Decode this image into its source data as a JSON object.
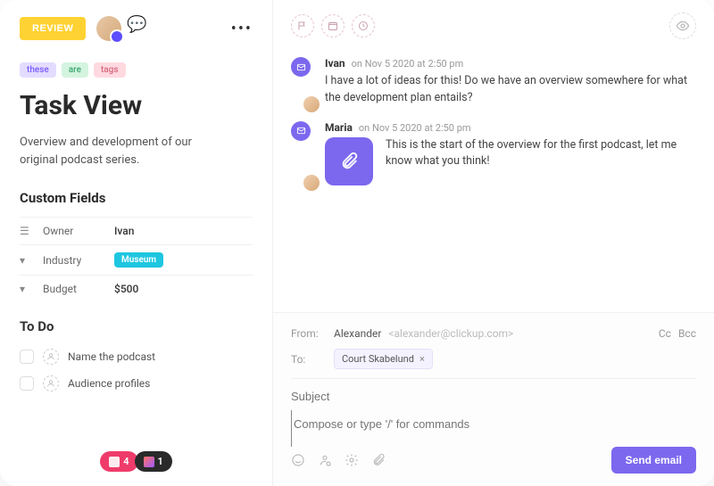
{
  "header": {
    "review_label": "REVIEW"
  },
  "tags": [
    "these",
    "are",
    "tags"
  ],
  "title": "Task View",
  "description": "Overview and development of our original podcast series.",
  "custom_fields": {
    "heading": "Custom Fields",
    "rows": [
      {
        "label": "Owner",
        "value": "Ivan"
      },
      {
        "label": "Industry",
        "value": "Museum"
      },
      {
        "label": "Budget",
        "value": "$500"
      }
    ]
  },
  "todo": {
    "heading": "To Do",
    "items": [
      {
        "label": "Name the podcast"
      },
      {
        "label": "Audience profiles"
      }
    ]
  },
  "footer_pills": {
    "red_count": "4",
    "dark_count": "1"
  },
  "comments": [
    {
      "author": "Ivan",
      "date": "on Nov 5 2020 at 2:50 pm",
      "text": "I have a lot of ideas for this! Do we have an overview somewhere for what the development plan entails?"
    },
    {
      "author": "Maria",
      "date": "on Nov 5 2020 at 2:50 pm",
      "text": "This is the start of the overview for the first podcast, let me know what you think!"
    }
  ],
  "composer": {
    "from_label": "From:",
    "from_name": "Alexander",
    "from_email": "<alexander@clickup.com>",
    "cc": "Cc",
    "bcc": "Bcc",
    "to_label": "To:",
    "to_chip": "Court Skabelund",
    "subject_placeholder": "Subject",
    "body_placeholder": "Compose or type '/' for commands",
    "send_label": "Send email"
  }
}
